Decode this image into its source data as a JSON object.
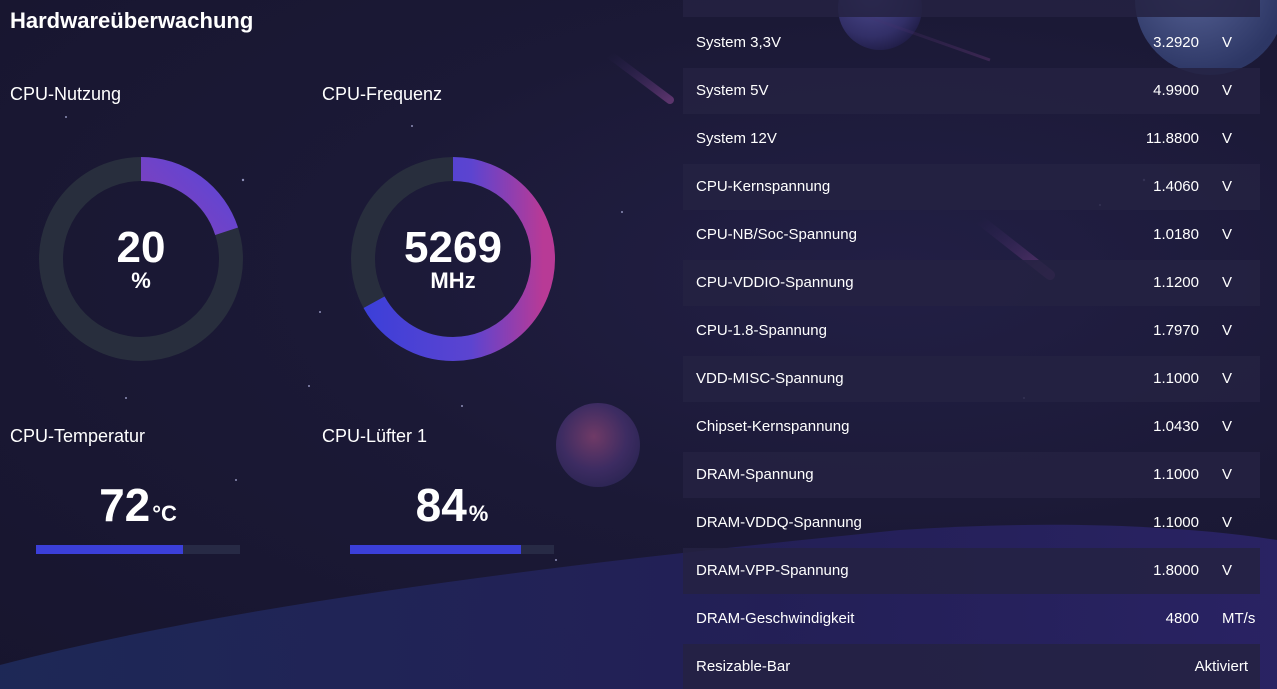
{
  "page_title": "Hardwareüberwachung",
  "cpu_usage": {
    "label": "CPU-Nutzung",
    "value": "20",
    "unit": "%",
    "percent": 20
  },
  "cpu_freq": {
    "label": "CPU-Frequenz",
    "value": "5269",
    "unit": "MHz",
    "percent": 67
  },
  "cpu_temp": {
    "label": "CPU-Temperatur",
    "value": "72",
    "unit": "°C",
    "percent": 72
  },
  "cpu_fan": {
    "label": "CPU-Lüfter 1",
    "value": "84",
    "unit": "%",
    "percent": 84
  },
  "colors": {
    "background": "#1a1833",
    "accent_blue": "#3b3fd9",
    "accent_pink": "#c23b8a",
    "ring_track": "#282e3d"
  },
  "sensors": [
    {
      "name": "System 3,3V",
      "value": "3.2920",
      "unit": "V"
    },
    {
      "name": "System 5V",
      "value": "4.9900",
      "unit": "V"
    },
    {
      "name": "System 12V",
      "value": "11.8800",
      "unit": "V"
    },
    {
      "name": "CPU-Kernspannung",
      "value": "1.4060",
      "unit": "V"
    },
    {
      "name": "CPU-NB/Soc-Spannung",
      "value": "1.0180",
      "unit": "V"
    },
    {
      "name": "CPU-VDDIO-Spannung",
      "value": "1.1200",
      "unit": "V"
    },
    {
      "name": "CPU-1.8-Spannung",
      "value": "1.7970",
      "unit": "V"
    },
    {
      "name": "VDD-MISC-Spannung",
      "value": "1.1000",
      "unit": "V"
    },
    {
      "name": "Chipset-Kernspannung",
      "value": "1.0430",
      "unit": "V"
    },
    {
      "name": "DRAM-Spannung",
      "value": "1.1000",
      "unit": "V"
    },
    {
      "name": "DRAM-VDDQ-Spannung",
      "value": "1.1000",
      "unit": "V"
    },
    {
      "name": "DRAM-VPP-Spannung",
      "value": "1.8000",
      "unit": "V"
    },
    {
      "name": "DRAM-Geschwindigkeit",
      "value": "4800",
      "unit": "MT/s"
    }
  ],
  "resizable_bar": {
    "name": "Resizable-Bar",
    "value": "Aktiviert"
  }
}
